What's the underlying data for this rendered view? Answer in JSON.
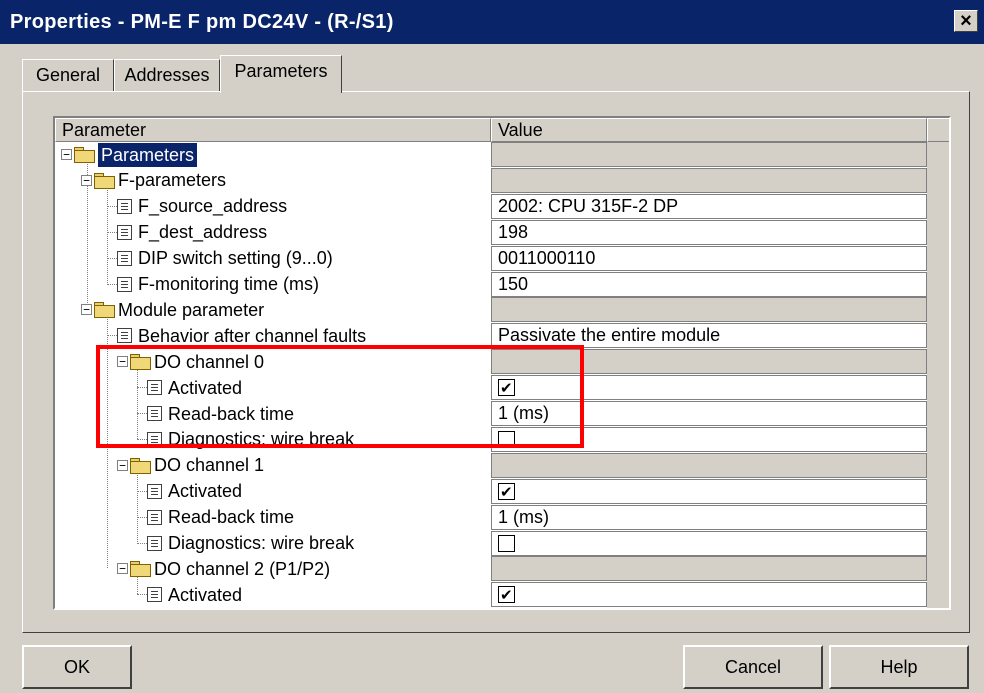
{
  "window": {
    "title": "Properties - PM-E F pm DC24V - (R-/S1)",
    "close_label": "×"
  },
  "tabs": [
    {
      "label": "General"
    },
    {
      "label": "Addresses"
    },
    {
      "label": "Parameters"
    }
  ],
  "grid": {
    "col_parameter": "Parameter",
    "col_value": "Value",
    "rows": [
      {
        "label": "Parameters",
        "value": ""
      },
      {
        "label": "F-parameters",
        "value": ""
      },
      {
        "label": "F_source_address",
        "value": "2002: CPU 315F-2 DP"
      },
      {
        "label": "F_dest_address",
        "value": "198"
      },
      {
        "label": "DIP switch setting (9...0)",
        "value": "0011000110"
      },
      {
        "label": "F-monitoring time (ms)",
        "value": "150"
      },
      {
        "label": "Module parameter",
        "value": ""
      },
      {
        "label": "Behavior after channel faults",
        "value": "Passivate the entire module"
      },
      {
        "label": "DO channel 0",
        "value": ""
      },
      {
        "label": "Activated",
        "checked": true
      },
      {
        "label": "Read-back time",
        "value": "1 (ms)"
      },
      {
        "label": "Diagnostics: wire break",
        "checked": false
      },
      {
        "label": "DO channel 1",
        "value": ""
      },
      {
        "label": "Activated",
        "checked": true
      },
      {
        "label": "Read-back time",
        "value": "1 (ms)"
      },
      {
        "label": "Diagnostics: wire break",
        "checked": false
      },
      {
        "label": "DO channel 2 (P1/P2)",
        "value": ""
      },
      {
        "label": "Activated",
        "checked": true
      }
    ]
  },
  "buttons": {
    "ok": "OK",
    "cancel": "Cancel",
    "help": "Help"
  },
  "colors": {
    "titlebar": "#0a246a",
    "dialog": "#d4d0c8",
    "highlight": "#ff0000"
  }
}
